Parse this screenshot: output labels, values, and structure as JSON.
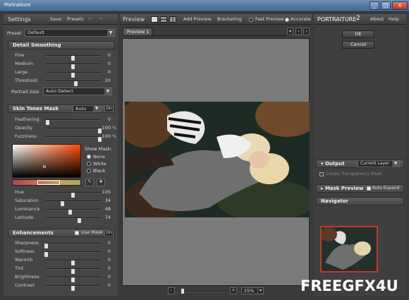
{
  "window": {
    "title": "Portraiture",
    "minimize": "_",
    "maximize": "□",
    "close": "X"
  },
  "settings": {
    "title": "Settings",
    "save": "Save",
    "presets": "Presets",
    "undo": "↶",
    "redo": "↷",
    "preset_label": "Preset",
    "preset_value": "Default",
    "detail": {
      "title": "Detail Smoothing",
      "rows": [
        {
          "label": "Fine",
          "value": "0",
          "level": 0.5
        },
        {
          "label": "Medium",
          "value": "0",
          "level": 0.5
        },
        {
          "label": "Large",
          "value": "0",
          "level": 0.5
        },
        {
          "label": "Threshold",
          "value": "20",
          "level": 0.55
        }
      ],
      "portrait_size_label": "Portrait Size",
      "portrait_size_value": "Auto Detect"
    },
    "skin": {
      "title": "Skin Tones Mask",
      "mode": "Auto",
      "toggle": "On",
      "rows": [
        {
          "label": "Feathering",
          "value": "0",
          "unit": "",
          "level": 0.02
        },
        {
          "label": "Opacity",
          "value": "100",
          "unit": "%",
          "level": 1.0
        },
        {
          "label": "Fuzziness",
          "value": "100",
          "unit": "%",
          "level": 1.0
        }
      ],
      "show_mask_label": "Show Mask:",
      "mask_options": [
        "None",
        "White",
        "Black"
      ],
      "mask_selected": 0,
      "hsl_rows": [
        {
          "label": "Hue",
          "value": "105",
          "level": 0.5
        },
        {
          "label": "Saturation",
          "value": "34",
          "level": 0.3
        },
        {
          "label": "Luminance",
          "value": "48",
          "level": 0.45
        },
        {
          "label": "Latitude",
          "value": "74",
          "level": 0.62
        }
      ]
    },
    "enh": {
      "title": "Enhancements",
      "use_mask": "Use Mask",
      "toggle": "On",
      "rows": [
        {
          "label": "Sharpness",
          "value": "0",
          "level": 0.0
        },
        {
          "label": "Softness",
          "value": "0",
          "level": 0.0
        },
        {
          "label": "Warmth",
          "value": "0",
          "level": 0.5
        },
        {
          "label": "Tint",
          "value": "0",
          "level": 0.5
        },
        {
          "label": "Brightness",
          "value": "0",
          "level": 0.5
        },
        {
          "label": "Contrast",
          "value": "0",
          "level": 0.5
        }
      ]
    }
  },
  "preview": {
    "title": "Preview",
    "add_preview": "Add Preview",
    "bracketing": "Bracketing",
    "fast_preview": "Fast Preview",
    "accurate": "Accurate",
    "mode_selected": "accurate",
    "tab": "Preview 1",
    "zoom": "25%",
    "minus": "-",
    "plus": "+"
  },
  "right": {
    "brand_a": "PORTRAITURE",
    "brand_b": "2",
    "about": "About",
    "help": "Help",
    "ok": "OK",
    "cancel": "Cancel",
    "output_label": "Output",
    "output_value": "Current Layer",
    "create_mask": "Create Transparency Mask",
    "mask_preview": "Mask Preview",
    "auto_expand": "Auto Expand",
    "navigator": "Navigator"
  },
  "watermark": {
    "a": "FREE",
    "b": "GFX",
    "c": "4U"
  },
  "colors": {
    "accent": "#c0392b",
    "panel": "#454545",
    "background": "#7a7a7a"
  }
}
